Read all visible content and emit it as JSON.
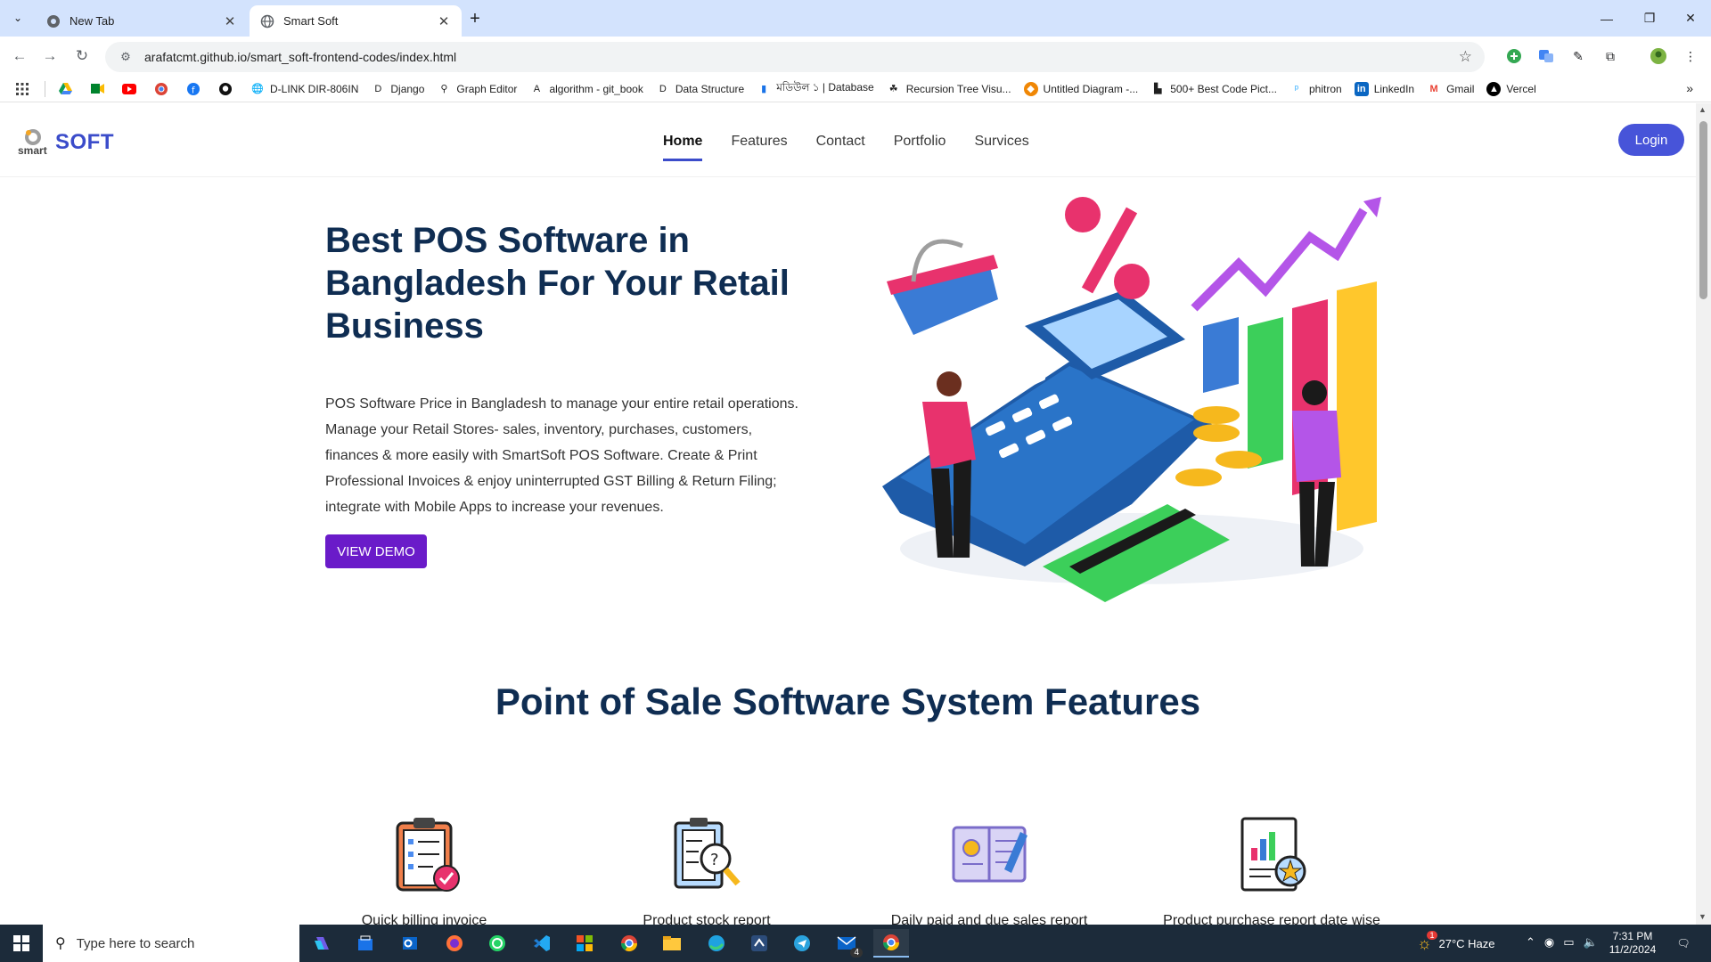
{
  "browser": {
    "tabs": [
      {
        "title": "New Tab",
        "active": false
      },
      {
        "title": "Smart Soft",
        "active": true
      }
    ],
    "url": "arafatcmt.github.io/smart_soft-frontend-codes/index.html",
    "bookmarks": [
      {
        "label": "",
        "icon": "google-drive-icon"
      },
      {
        "label": "",
        "icon": "google-meet-icon"
      },
      {
        "label": "",
        "icon": "youtube-icon"
      },
      {
        "label": "",
        "icon": "chrome-web-store-icon"
      },
      {
        "label": "",
        "icon": "facebook-icon"
      },
      {
        "label": "",
        "icon": "github-icon"
      },
      {
        "label": "D-LINK DIR-806IN",
        "icon": "globe-icon"
      },
      {
        "label": "Django",
        "icon": "letter-d-icon"
      },
      {
        "label": "Graph Editor",
        "icon": "graph-icon"
      },
      {
        "label": "algorithm - git_book",
        "icon": "letter-a-icon"
      },
      {
        "label": "Data Structure",
        "icon": "letter-d-icon"
      },
      {
        "label": "মডিউল ১ | Database",
        "icon": "bookmark-icon"
      },
      {
        "label": "Recursion Tree Visu...",
        "icon": "tree-icon"
      },
      {
        "label": "Untitled Diagram -...",
        "icon": "drawio-icon"
      },
      {
        "label": "500+ Best Code Pict...",
        "icon": "unsplash-icon"
      },
      {
        "label": "phitron",
        "icon": "phitron-icon"
      },
      {
        "label": "LinkedIn",
        "icon": "linkedin-icon"
      },
      {
        "label": "Gmail",
        "icon": "gmail-icon"
      },
      {
        "label": "Vercel",
        "icon": "vercel-icon"
      }
    ]
  },
  "site": {
    "brand": "SOFT",
    "logo_sub": "smart",
    "nav": [
      {
        "label": "Home",
        "active": true
      },
      {
        "label": "Features",
        "active": false
      },
      {
        "label": "Contact",
        "active": false
      },
      {
        "label": "Portfolio",
        "active": false
      },
      {
        "label": "Survices",
        "active": false
      }
    ],
    "login_label": "Login",
    "hero": {
      "title": "Best POS Software in Bangladesh For Your Retail Business",
      "text": "POS Software Price in Bangladesh to manage your entire retail operations. Manage your Retail Stores- sales, inventory, purchases, customers, finances & more easily with SmartSoft POS Software. Create & Print Professional Invoices & enjoy uninterrupted GST Billing & Return Filing; integrate with Mobile Apps to increase your revenues.",
      "button": "VIEW DEMO"
    },
    "features": {
      "title": "Point of Sale Software System Features",
      "items": [
        {
          "label": "Quick billing invoice",
          "icon": "clipboard-checklist-icon"
        },
        {
          "label": "Product stock report",
          "icon": "report-magnifier-icon"
        },
        {
          "label": "Daily paid and due sales report",
          "icon": "ledger-book-icon"
        },
        {
          "label": "Product purchase report date wise",
          "icon": "chart-document-icon"
        }
      ]
    }
  },
  "taskbar": {
    "search_placeholder": "Type here to search",
    "weather": "27°C  Haze",
    "time": "7:31 PM",
    "date": "11/2/2024",
    "mail_badge": "4",
    "weather_badge": "1"
  },
  "colors": {
    "brand": "#3b4cca",
    "title": "#0f2d52",
    "demo_button": "#6a1bc9",
    "tabbar": "#d3e3fd"
  }
}
